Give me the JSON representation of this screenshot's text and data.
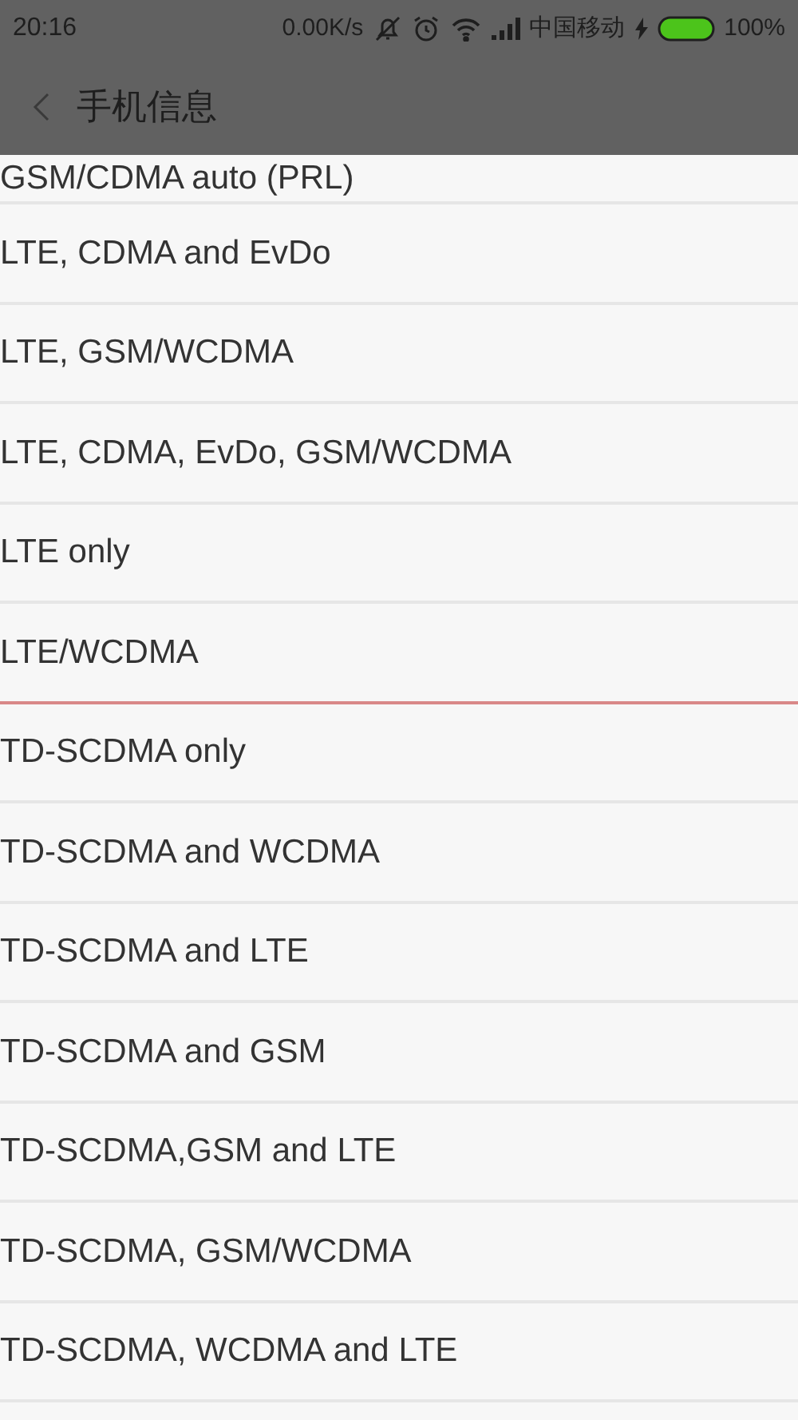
{
  "status_bar": {
    "time": "20:16",
    "speed": "0.00K/s",
    "carrier": "中国移动",
    "battery": "100%",
    "charging": true
  },
  "header": {
    "title": "手机信息"
  },
  "options": [
    {
      "label": "GSM/CDMA auto (PRL)",
      "marked": false
    },
    {
      "label": "LTE, CDMA and EvDo",
      "marked": false
    },
    {
      "label": "LTE, GSM/WCDMA",
      "marked": false
    },
    {
      "label": "LTE, CDMA, EvDo, GSM/WCDMA",
      "marked": false
    },
    {
      "label": "LTE only",
      "marked": false
    },
    {
      "label": "LTE/WCDMA",
      "marked": true
    },
    {
      "label": "TD-SCDMA only",
      "marked": false
    },
    {
      "label": "TD-SCDMA and WCDMA",
      "marked": false
    },
    {
      "label": "TD-SCDMA and LTE",
      "marked": false
    },
    {
      "label": "TD-SCDMA and GSM",
      "marked": false
    },
    {
      "label": "TD-SCDMA,GSM and LTE",
      "marked": false
    },
    {
      "label": "TD-SCDMA, GSM/WCDMA",
      "marked": false
    },
    {
      "label": "TD-SCDMA, WCDMA and LTE",
      "marked": false
    }
  ]
}
